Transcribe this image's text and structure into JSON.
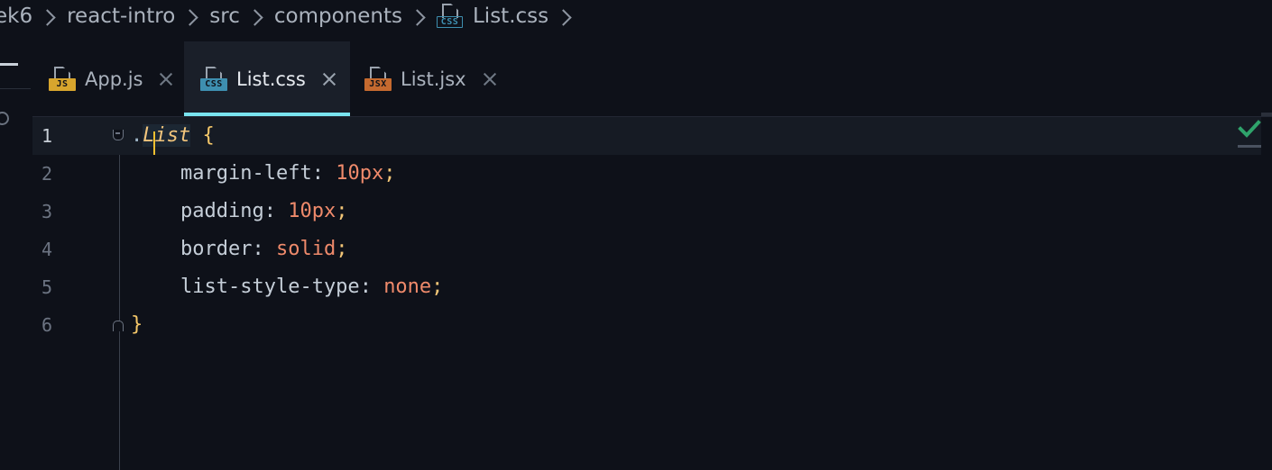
{
  "breadcrumb": {
    "items": [
      "ek6",
      "react-intro",
      "src",
      "components"
    ],
    "file": "List.css",
    "file_type": "CSS"
  },
  "tabs": [
    {
      "label": "App.js",
      "type": "JS",
      "active": false
    },
    {
      "label": "List.css",
      "type": "CSS",
      "active": true
    },
    {
      "label": "List.jsx",
      "type": "JSX",
      "active": false
    }
  ],
  "editor": {
    "line_numbers": [
      "1",
      "2",
      "3",
      "4",
      "5",
      "6"
    ],
    "current_line": 1,
    "selector_dot": ".",
    "selector_name": "List",
    "open_brace": "{",
    "close_brace": "}",
    "declarations": [
      {
        "property": "margin-left",
        "value": "10px"
      },
      {
        "property": "padding",
        "value": "10px"
      },
      {
        "property": "border",
        "value": "solid"
      },
      {
        "property": "list-style-type",
        "value": "none"
      }
    ],
    "colon": ":",
    "semicolon": ";"
  },
  "status": {
    "icon": "check-icon",
    "color": "#2fa36b"
  },
  "colors": {
    "accent": "#79e3ef",
    "css": "#3e8fb0",
    "js": "#d7a52d",
    "jsx": "#c56a2f"
  }
}
